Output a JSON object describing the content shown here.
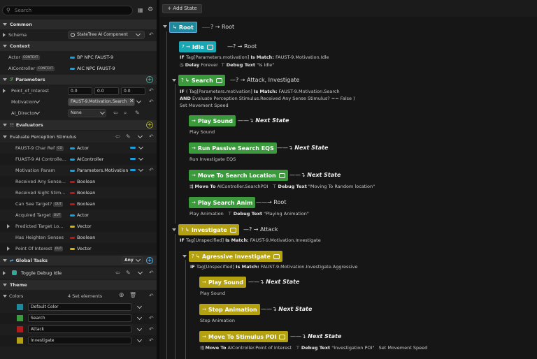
{
  "colors": {
    "teal": "#1c8a9c",
    "cyan": "#18a7b5",
    "green": "#3b9a3b",
    "yellow": "#b3a112",
    "accent_blue": "#1ba1e2",
    "red_pill": "#b31b1b",
    "yellow_pill": "#d4b21a",
    "panel": "#1e1e1e"
  },
  "search": {
    "placeholder": "Search"
  },
  "common": {
    "header": "Common",
    "schema_label": "Schema",
    "schema_value": "StateTree AI Component"
  },
  "context": {
    "header": "Context",
    "actor_label": "Actor",
    "actor_badge": "CONTEXT",
    "actor_value": "BP NPC FAUST-9",
    "aic_label": "AIController",
    "aic_badge": "CONTEXT",
    "aic_value": "AIC NPC FAUST-9"
  },
  "parameters": {
    "header": "Parameters",
    "poi_label": "Point_of_Interest",
    "poi_x": "0.0",
    "poi_y": "0.0",
    "poi_z": "0.0",
    "motivation_label": "Motivation",
    "motivation_value": "FAUST-9.Motivation.Search",
    "director_label": "AI_Director",
    "director_value": "None"
  },
  "evaluators": {
    "header": "Evaluators",
    "item": "Evaluate Perception Stimulus",
    "rows": [
      {
        "label": "FAUST-9 Char Ref",
        "badge": "CO",
        "value": "Actor",
        "pill": "blue"
      },
      {
        "label": "FUAST-9 AI Controlle...",
        "badge": "",
        "value": "AIController",
        "pill": "blue"
      },
      {
        "label": "Motivation Param",
        "badge": "",
        "value": "Parameters.Motivation",
        "pill": "blue"
      },
      {
        "label": "Received Any Sense...",
        "badge": "",
        "value": "Boolean",
        "pill": "red"
      },
      {
        "label": "Received Sight Stim...",
        "badge": "",
        "value": "Boolean",
        "pill": "red"
      },
      {
        "label": "Can See Target?",
        "badge": "OUT",
        "value": "Boolean",
        "pill": "red"
      },
      {
        "label": "Acquired Target",
        "badge": "OUT",
        "value": "Actor",
        "pill": "blue"
      },
      {
        "label": "Predicted Target Lo...",
        "badge": "",
        "value": "Vector",
        "pill": "yellow"
      },
      {
        "label": "Has Heighten Senses",
        "badge": "",
        "value": "Boolean",
        "pill": "red"
      },
      {
        "label": "Point Of Interest",
        "badge": "OUT",
        "value": "Vector",
        "pill": "yellow"
      }
    ]
  },
  "global_tasks": {
    "header": "Global Tasks",
    "any_label": "Any",
    "item": "Toggle Debug Idle"
  },
  "theme": {
    "header": "Theme",
    "colors_label": "Colors",
    "count": "4 Set elements",
    "entries": [
      {
        "name": "Default Color",
        "color": "#1c8a9c"
      },
      {
        "name": "Search",
        "color": "#3b9a3b"
      },
      {
        "name": "Attack",
        "color": "#b31b1b"
      },
      {
        "name": "Investigate",
        "color": "#b3a112"
      }
    ]
  },
  "toolbar": {
    "add_state": "+ Add State"
  },
  "tree": {
    "root": {
      "name": "Root",
      "trans": "? → Root"
    },
    "idle": {
      "name": "Idle",
      "trans": "? → Root",
      "cond": "Tag[Parameters.motivation]",
      "ismatch": "FAUST-9.Motivation.Idle",
      "delay_label": "Delay",
      "delay_value": "Forever",
      "debug_label": "Debug Text",
      "debug_value": "\"Is Idle\""
    },
    "search": {
      "name": "Search",
      "trans": "? → Attack, Investigate",
      "cond1": "( Tag[Parameters.motivation]",
      "ismatch": "FAUST-9.Motivation.Search",
      "cond2": "Evaluate Perception Stimulus.Received Any Sense Stimulus?",
      "cond2b": "== False )",
      "extra": "Set Movement Speed"
    },
    "play_sound": {
      "name": "Play Sound",
      "next": "Next State",
      "desc": "Play Sound"
    },
    "run_eqs": {
      "name": "Run Passive Search EQS",
      "next": "Next State",
      "desc": "Run Investigate EQS"
    },
    "move_loc": {
      "name": "Move To Search Location",
      "next": "Next State",
      "mt_label": "Move To",
      "mt_value": "AIController.SearchPOI",
      "debug_label": "Debug Text",
      "debug_value": "\"Moving To Random location\""
    },
    "play_anim": {
      "name": "Play Search Anim",
      "trans": "Root",
      "desc": "Play Animation",
      "debug_label": "Debug Text",
      "debug_value": "\"Playing Animation\""
    },
    "investigate": {
      "name": "Investigate",
      "trans": "? → Attack",
      "cond": "Tag[Unspecified]",
      "ismatch": "FAUST-9.Motivation.Investigate"
    },
    "agressive": {
      "name": "Agressive Investigate",
      "cond": "Tag[Unspecified]",
      "ismatch": "FAUST-9.Motivation.Investigate.Aggressive"
    },
    "play_sound2": {
      "name": "Play Sound",
      "next": "Next State",
      "desc": "Play Sound"
    },
    "stop_anim": {
      "name": "Stop Animation",
      "next": "Next State",
      "desc": "Stop Animation"
    },
    "move_poi": {
      "name": "Move To Stimulus POI",
      "next": "Next State",
      "mt_label": "Move To",
      "mt_value": "AIController.Point of Interest",
      "debug_label": "Debug Text",
      "debug_value": "\"Investigation POI\"",
      "extra": "Set Movement Speed"
    },
    "if_kw": "IF",
    "and_kw": "AND",
    "ismatch_kw": "Is Match:"
  }
}
